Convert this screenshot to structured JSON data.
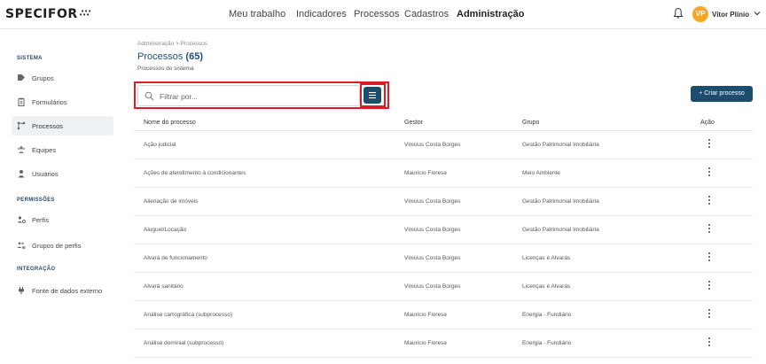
{
  "app": {
    "logo": "SPECIFOR",
    "logo_mark": "∴∵"
  },
  "nav": {
    "items": [
      {
        "label": "Meu trabalho",
        "active": false
      },
      {
        "label": "Indicadores",
        "active": false
      },
      {
        "label": "Processos",
        "active": false
      },
      {
        "label": "Cadastros",
        "active": false
      },
      {
        "label": "Administração",
        "active": true
      }
    ]
  },
  "user": {
    "initials": "VP",
    "name": "Vitor Plínio",
    "avatar_color": "#f5a623",
    "icons": [
      "bell-icon",
      "chevron-down-icon"
    ]
  },
  "sidebar": {
    "sections": [
      {
        "title": "SISTEMA"
      },
      {
        "title": "PERMISSÕES"
      },
      {
        "title": "INTEGRAÇÃO"
      }
    ],
    "items": [
      {
        "label": "Grupos",
        "icon": "tag-icon",
        "active": false
      },
      {
        "label": "Formulários",
        "icon": "clipboard-icon",
        "active": false
      },
      {
        "label": "Processos",
        "icon": "process-flow-icon",
        "active": true
      },
      {
        "label": "Equipes",
        "icon": "team-icon",
        "active": false
      },
      {
        "label": "Usuários",
        "icon": "user-icon",
        "active": false
      },
      {
        "label": "Perfis",
        "icon": "profile-icon",
        "active": false
      },
      {
        "label": "Grupos de perfis",
        "icon": "profile-group-icon",
        "active": false
      },
      {
        "label": "Fonte de dados externo",
        "icon": "plug-icon",
        "active": false
      }
    ]
  },
  "page": {
    "breadcrumb": "Administração > Processos",
    "title": "Processos",
    "count": "(65)",
    "subtitle": "Processos do sistema"
  },
  "search": {
    "placeholder": "Filtrar por...",
    "value": ""
  },
  "actions": {
    "create_label": "+ Criar processo"
  },
  "table": {
    "headers": [
      "Nome do processo",
      "Gestor",
      "Grupo",
      "Ação"
    ],
    "rows": [
      {
        "name": "Ação judicial",
        "manager": "Vinicius Costa Borges",
        "group": "Gestão Patrimonial Imobiliária"
      },
      {
        "name": "Ações de atendimento à condicionantes",
        "manager": "Mauricio Fiorese",
        "group": "Meio Ambiente"
      },
      {
        "name": "Alienação de imóveis",
        "manager": "Vinicius Costa Borges",
        "group": "Gestão Patrimonial Imobiliária"
      },
      {
        "name": "Aluguel/Locação",
        "manager": "Vinicius Costa Borges",
        "group": "Gestão Patrimonial Imobiliária"
      },
      {
        "name": "Alvará de funcionamento",
        "manager": "Vinicius Costa Borges",
        "group": "Licenças e Alvarás"
      },
      {
        "name": "Alvará sanitário",
        "manager": "Vinicius Costa Borges",
        "group": "Licenças e Alvarás"
      },
      {
        "name": "Análise cartográfica (subprocesso)",
        "manager": "Mauricio Fiorese",
        "group": "Energia - Fundiário"
      },
      {
        "name": "Análise dominial (subprocesso)",
        "manager": "Mauricio Fiorese",
        "group": "Energia - Fundiário"
      }
    ]
  },
  "colors": {
    "primary": "#1a4d6e",
    "title": "#1d4e7a",
    "highlight": "#e01b24",
    "active_bg": "#eef2f5"
  }
}
